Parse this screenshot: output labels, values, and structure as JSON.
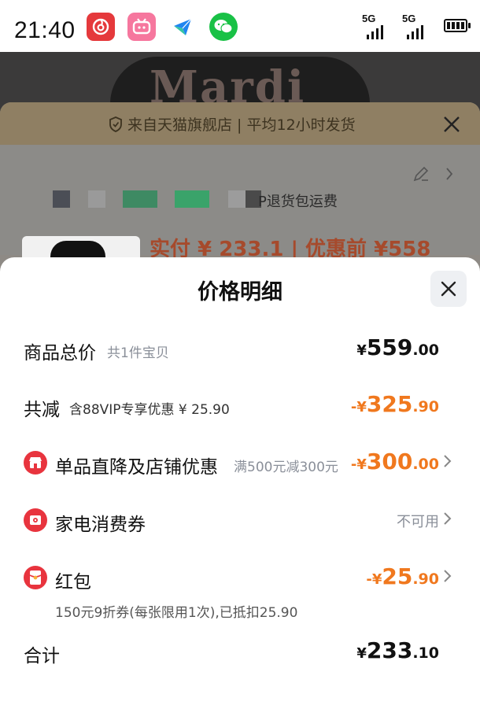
{
  "status_bar": {
    "time": "21:40",
    "apps": [
      "netease-music-icon",
      "bilibili-icon",
      "feishu-icon",
      "wechat-icon"
    ],
    "signal_1": "5G",
    "signal_2": "5G"
  },
  "background": {
    "brand": "Mardi",
    "banner_text": "来自天猫旗舰店 | 平均12小时发货",
    "return_text": "P退货包运费",
    "price_text": "实付 ¥ 233.1 | 优惠前 ¥558"
  },
  "sheet": {
    "title": "价格明细",
    "total_price": {
      "label": "商品总价",
      "sub": "共1件宝贝",
      "prefix": "¥",
      "int": "559",
      "dec": ".00"
    },
    "discount": {
      "label": "共减",
      "sub": "含88VIP专享优惠 ¥ 25.90",
      "prefix": "-¥",
      "int": "325",
      "dec": ".90"
    },
    "store_discount": {
      "label": "单品直降及店铺优惠",
      "sub": "满500元减300元",
      "prefix": "-¥",
      "int": "300",
      "dec": ".00"
    },
    "appliance_coupon": {
      "label": "家电消费券",
      "status": "不可用"
    },
    "red_packet": {
      "label": "红包",
      "prefix": "-¥",
      "int": "25",
      "dec": ".90",
      "note": "150元9折券(每张限用1次),已抵扣25.90"
    },
    "sum": {
      "label": "合计",
      "prefix": "¥",
      "int": "233",
      "dec": ".10"
    }
  },
  "colors": {
    "accent_orange": "#f0781e",
    "icon_red": "#e8343e"
  }
}
